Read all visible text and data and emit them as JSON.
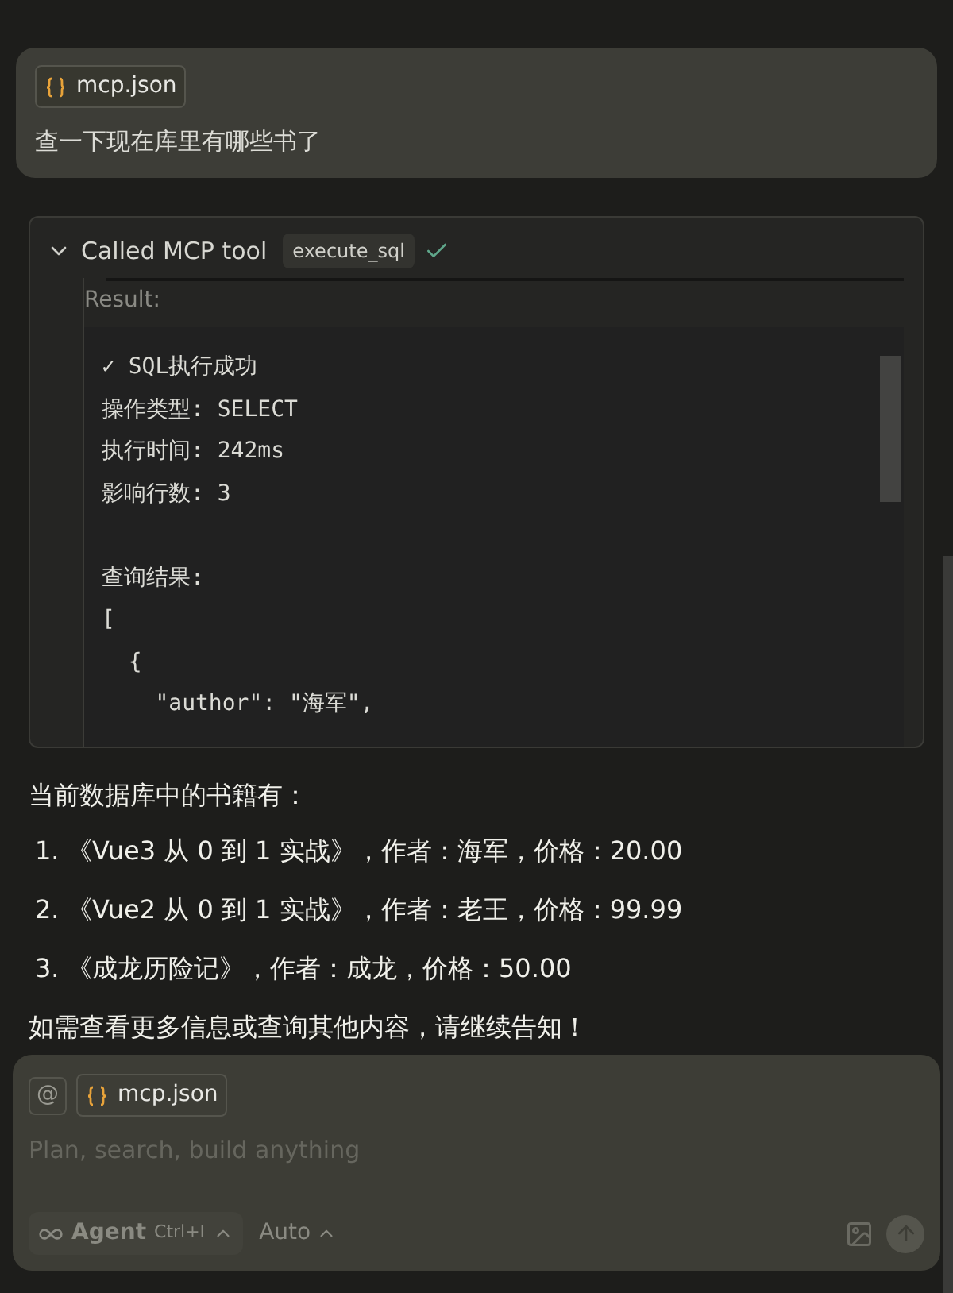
{
  "user_message": {
    "attachment": "mcp.json",
    "text": "查一下现在库里有哪些书了"
  },
  "tool_call": {
    "expanded": true,
    "label": "Called MCP tool",
    "tool": "execute_sql",
    "result_label": "Result:",
    "output_blocks": [
      [
        "✓ SQL执行成功",
        "操作类型: SELECT",
        "执行时间: 242ms",
        "影响行数: 3"
      ],
      [
        "查询结果:",
        "[",
        "  {",
        "    \"author\": \"海军\","
      ]
    ]
  },
  "answer": {
    "intro": "当前数据库中的书籍有：",
    "items": [
      {
        "number": "1.",
        "text": "《Vue3 从 0 到 1 实战》，作者：海军，价格：20.00"
      },
      {
        "number": "2.",
        "text": "《Vue2 从 0 到 1 实战》，作者：老王，价格：99.99"
      },
      {
        "number": "3.",
        "text": "《成龙历险记》，作者：成龙，价格：50.00"
      }
    ],
    "outro": "如需查看更多信息或查询其他内容，请继续告知！"
  },
  "composer": {
    "mention": "@",
    "attachment": "mcp.json",
    "placeholder": "Plan, search, build anything",
    "mode": "Agent",
    "shortcut": "Ctrl+I",
    "model": "Auto"
  }
}
